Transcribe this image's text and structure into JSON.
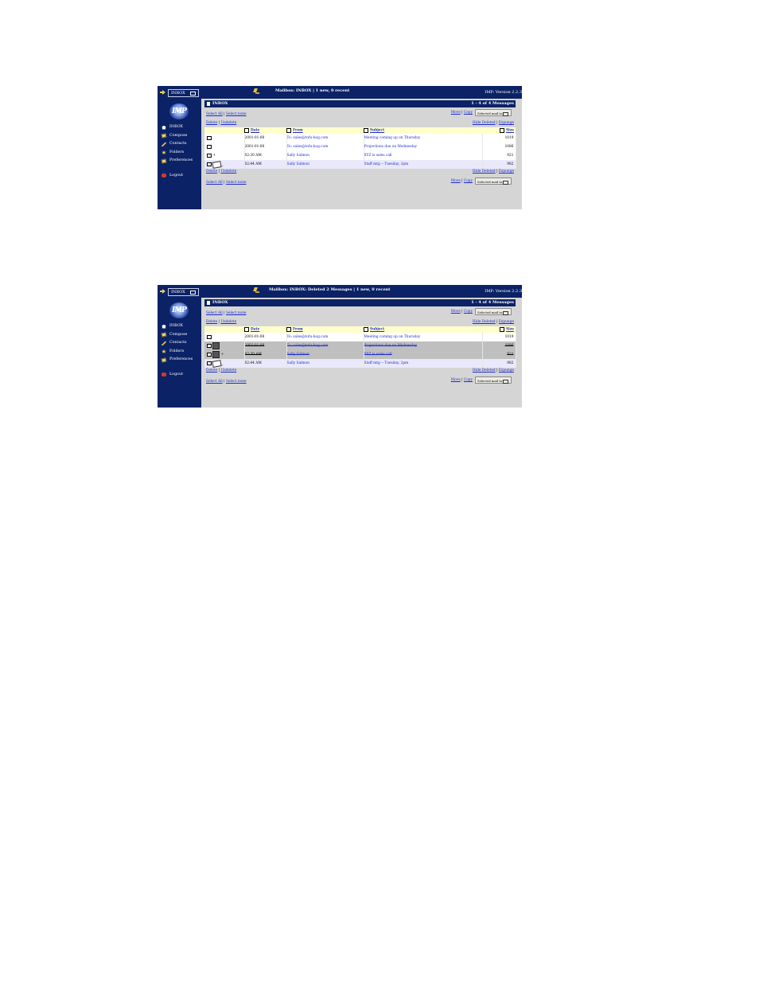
{
  "screenshots": [
    {
      "topbar": {
        "folder_select": "INBOX",
        "mailbox_status": "Mailbox: INBOX | 1 new, 0 recent",
        "version": "IMP: Version 2.2.3"
      },
      "logo_text": "IMP",
      "nav": [
        "INBOX",
        "Compose",
        "Contacts",
        "Folders",
        "Preferences",
        "Logout"
      ],
      "header": {
        "title": "INBOX",
        "count": "1 - 4 of 4 Messages"
      },
      "select_links": {
        "select_all": "Select All",
        "select_none": "Select none"
      },
      "move_links": {
        "move": "Move",
        "copy": "Copy"
      },
      "move_select": "Selected mail to:",
      "actions": {
        "delete": "Delete",
        "undelete": "Undelete",
        "hide_deleted": "Hide Deleted",
        "expunge": "Expunge"
      },
      "columns": {
        "date": "Date",
        "from": "From",
        "subject": "Subject",
        "size": "Size"
      },
      "rows": [
        {
          "flag": "",
          "date": "2001-01-08",
          "from": "To: sales@tofu-hog.com",
          "subject": "Meeting coming up on Thursday",
          "size": "1019"
        },
        {
          "flag": "",
          "date": "2001-01-08",
          "from": "To: sales@tofu-hog.com",
          "subject": "Projections due on Wednesday",
          "size": "1086"
        },
        {
          "flag": "+",
          "date": "02:30 AM",
          "from": "Sally Salmon",
          "subject": "XYZ is sales call",
          "size": "921"
        },
        {
          "flag": "",
          "date": "02:44 AM",
          "from": "Sally Salmon",
          "subject": "Staff mtg -- Tuesday, 2pm",
          "size": "982"
        }
      ]
    },
    {
      "topbar": {
        "folder_select": "INBOX",
        "mailbox_status": "Mailbox: INBOX: Deleted 2 Messages | 1 new, 0 recent",
        "version": "IMP: Version 2.2.3"
      },
      "logo_text": "IMP",
      "nav": [
        "INBOX",
        "Compose",
        "Contacts",
        "Folders",
        "Preferences",
        "Logout"
      ],
      "header": {
        "title": "INBOX",
        "count": "1 - 4 of 4 Messages"
      },
      "select_links": {
        "select_all": "Select All",
        "select_none": "Select none"
      },
      "move_links": {
        "move": "Move",
        "copy": "Copy"
      },
      "move_select": "Selected mail to:",
      "actions": {
        "delete": "Delete",
        "undelete": "Undelete",
        "hide_deleted": "Hide Deleted",
        "expunge": "Expunge"
      },
      "columns": {
        "date": "Date",
        "from": "From",
        "subject": "Subject",
        "size": "Size"
      },
      "rows": [
        {
          "flag": "",
          "date": "2001-01-08",
          "from": "To: sales@tofu-hog.com",
          "subject": "Meeting coming up on Thursday",
          "size": "1019"
        },
        {
          "flag": "",
          "date": "2001-01-08",
          "from": "To: sales@tofu-hog.com",
          "subject": "Projections due on Wednesday",
          "size": "1086"
        },
        {
          "flag": "+",
          "date": "02:30 AM",
          "from": "Sally Salmon",
          "subject": "XYZ is sales call",
          "size": "921"
        },
        {
          "flag": "",
          "date": "02:44 AM",
          "from": "Sally Salmon",
          "subject": "Staff mtg -- Tuesday, 2pm",
          "size": "982"
        }
      ]
    }
  ]
}
